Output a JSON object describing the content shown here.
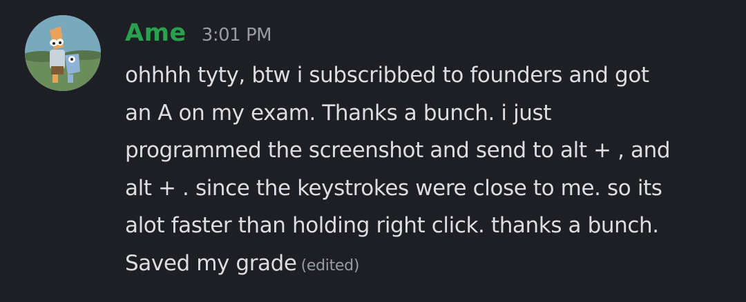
{
  "message": {
    "username": "Ame",
    "timestamp": "3:01 PM",
    "lines": [
      "ohhhh tyty, btw i subscribbed to founders and got",
      "an A on my exam. Thanks a bunch. i just",
      "programmed the screenshot and send to alt + , and",
      "alt + . since the keystrokes were close to me. so its",
      "alot faster than holding right click. thanks a bunch.",
      "Saved my grade"
    ],
    "edited_label": "(edited)"
  },
  "colors": {
    "background": "#1e1f24",
    "username": "#2aa14f",
    "text": "#dddee3",
    "muted": "#9a9ba3"
  },
  "icons": {
    "avatar": "user-avatar-cartoon-icon"
  }
}
